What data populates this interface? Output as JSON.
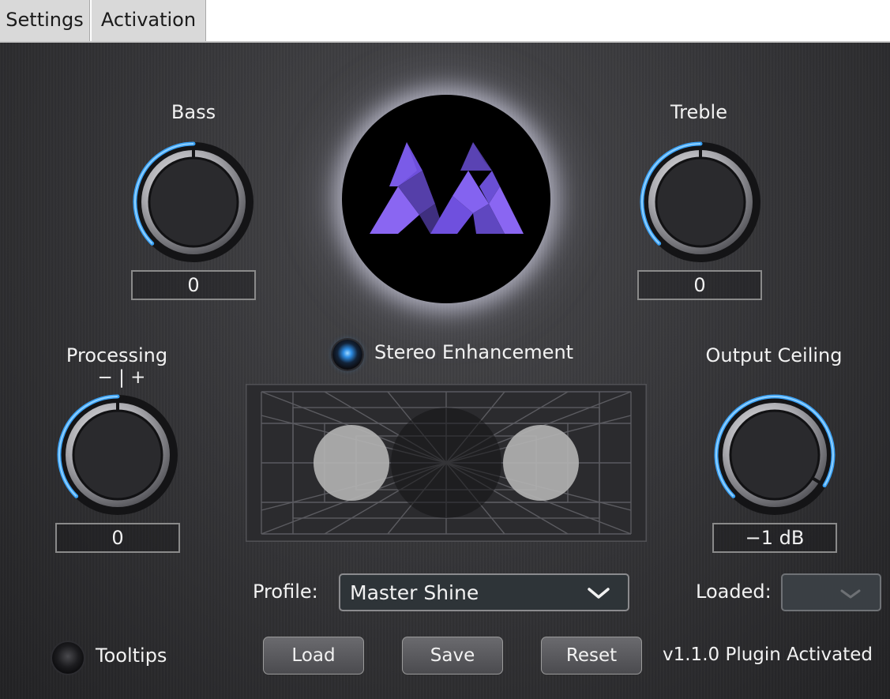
{
  "tabs": [
    {
      "label": "Settings"
    },
    {
      "label": "Activation"
    }
  ],
  "knobs": {
    "bass": {
      "label": "Bass",
      "value": "0",
      "level": 0.5
    },
    "treble": {
      "label": "Treble",
      "value": "0",
      "level": 0.5
    },
    "processing": {
      "label": "Processing",
      "scale": "− | +",
      "value": "0",
      "level": 0.5
    },
    "output_ceiling": {
      "label": "Output Ceiling",
      "value": "−1 dB",
      "level": 0.95
    }
  },
  "stereo": {
    "label": "Stereo Enhancement",
    "enabled": true
  },
  "profile": {
    "label": "Profile:",
    "selected": "Master Shine"
  },
  "loaded": {
    "label": "Loaded:",
    "selected": ""
  },
  "tooltips": {
    "label": "Tooltips",
    "enabled": false
  },
  "buttons": {
    "load": "Load",
    "save": "Save",
    "reset": "Reset"
  },
  "status": "v1.1.0 Plugin Activated",
  "colors": {
    "accent": "#3aa6ff",
    "logo_purple": "#7b5ce6",
    "logo_purple_dark": "#4e3a9e"
  },
  "icons": {
    "dropdown": "chevron-down-icon",
    "led": "led-indicator-icon"
  }
}
